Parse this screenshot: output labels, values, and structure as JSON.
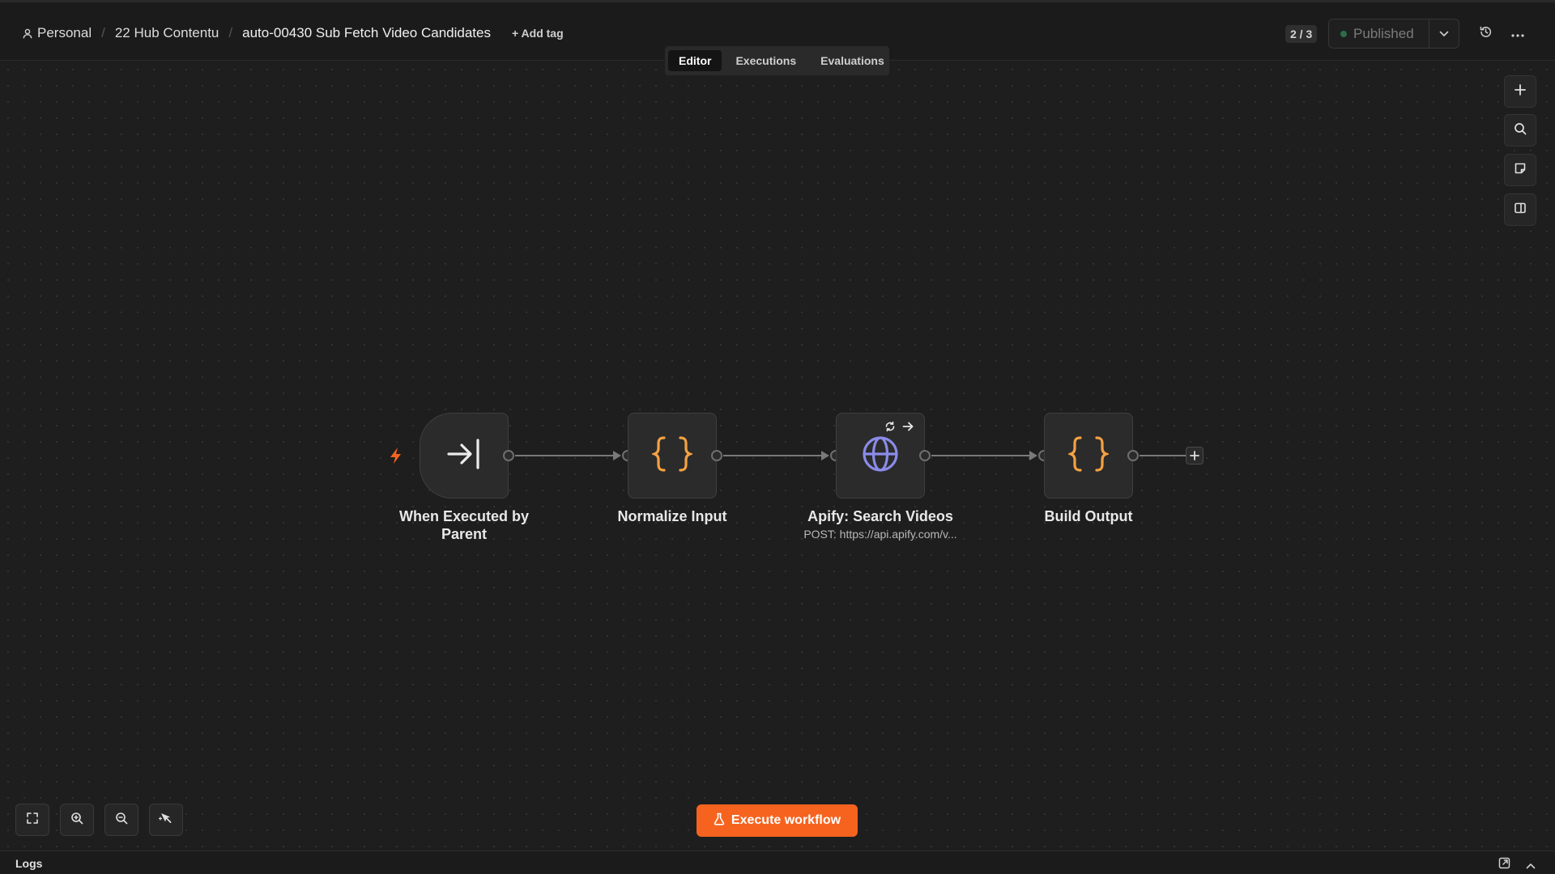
{
  "header": {
    "breadcrumb": {
      "owner": "Personal",
      "project": "22 Hub Contentu",
      "workflow": "auto-00430 Sub Fetch Video Candidates"
    },
    "add_tag": "+ Add tag",
    "version_counter": "2 / 3",
    "publish_status": "Published"
  },
  "tabs": [
    {
      "label": "Editor",
      "active": true
    },
    {
      "label": "Executions",
      "active": false
    },
    {
      "label": "Evaluations",
      "active": false
    }
  ],
  "nodes": [
    {
      "label_line1": "When Executed by",
      "label_line2": "Parent",
      "icon": "sign-in-arrow-icon"
    },
    {
      "label": "Normalize Input",
      "icon": "curly-braces-icon"
    },
    {
      "label": "Apify: Search Videos",
      "subtitle": "POST: https://api.apify.com/v...",
      "icon": "globe-icon"
    },
    {
      "label": "Build Output",
      "icon": "curly-braces-icon"
    }
  ],
  "execute_button": "Execute workflow",
  "logs": {
    "label": "Logs"
  },
  "colors": {
    "accent": "#f5631f",
    "code_icon": "#f5a142",
    "globe_icon": "#8b8bea",
    "trigger_bolt": "#f5631f"
  }
}
